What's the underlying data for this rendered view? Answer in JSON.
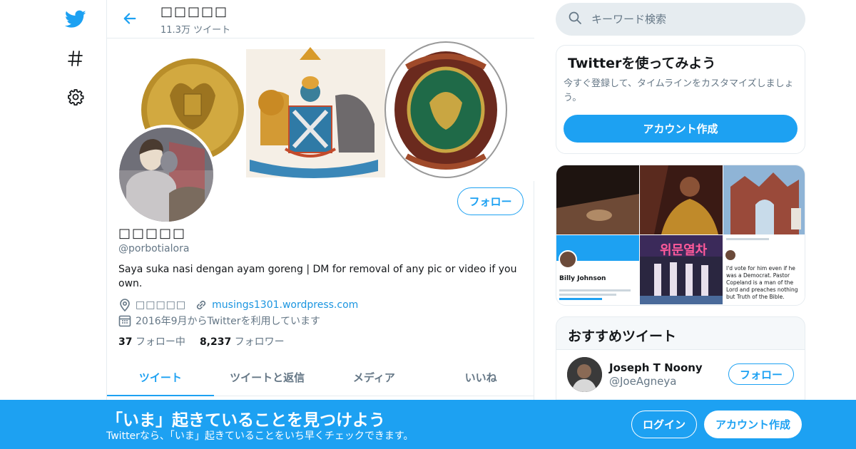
{
  "nav": {
    "icons": [
      "twitter-bird-icon",
      "hashtag-icon",
      "gear-icon"
    ]
  },
  "header": {
    "name": "□□□□□",
    "tweet_count": "11.3万 ツイート"
  },
  "profile": {
    "name": "□□□□□",
    "handle": "@porbotialora",
    "follow_label": "フォロー",
    "bio": "Saya suka nasi dengan ayam goreng | DM for removal of any pic or video if you own.",
    "location": "□□□□□",
    "website": "musings1301.wordpress.com",
    "joined": "2016年9月からTwitterを利用しています",
    "following_count": "37",
    "following_label": "フォロー中",
    "followers_count": "8,237",
    "followers_label": "フォロワー"
  },
  "tabs": [
    {
      "label": "ツイート",
      "active": true
    },
    {
      "label": "ツイートと返信",
      "active": false
    },
    {
      "label": "メディア",
      "active": false
    },
    {
      "label": "いいね",
      "active": false
    }
  ],
  "search": {
    "placeholder": "キーワード検索"
  },
  "signup_card": {
    "title": "Twitterを使ってみよう",
    "text": "今すぐ登録して、タイムラインをカスタマイズしましょう。",
    "button": "アカウント作成"
  },
  "media_thumbs": [
    {
      "text": ""
    },
    {
      "text": ""
    },
    {
      "text": ""
    },
    {
      "text": "Billy Johnson"
    },
    {
      "text": "위문열차"
    },
    {
      "text": "I'd vote for him even if he was a Democrat. Pastor Copeland is a man of the Lord and preaches nothing but Truth of the Bible."
    }
  ],
  "recommended": {
    "title": "おすすめツイート",
    "user_name": "Joseph T Noony",
    "user_handle": "@JoeAgneya",
    "follow_label": "フォロー"
  },
  "bottom_bar": {
    "title": "「いま」起きていることを見つけよう",
    "subtitle": "Twitterなら、「いま」起きていることをいち早くチェックできます。",
    "login": "ログイン",
    "signup": "アカウント作成"
  },
  "colors": {
    "accent": "#1da1f2",
    "link": "#1b95e0",
    "muted": "#657786",
    "border": "#e6ecf0"
  }
}
